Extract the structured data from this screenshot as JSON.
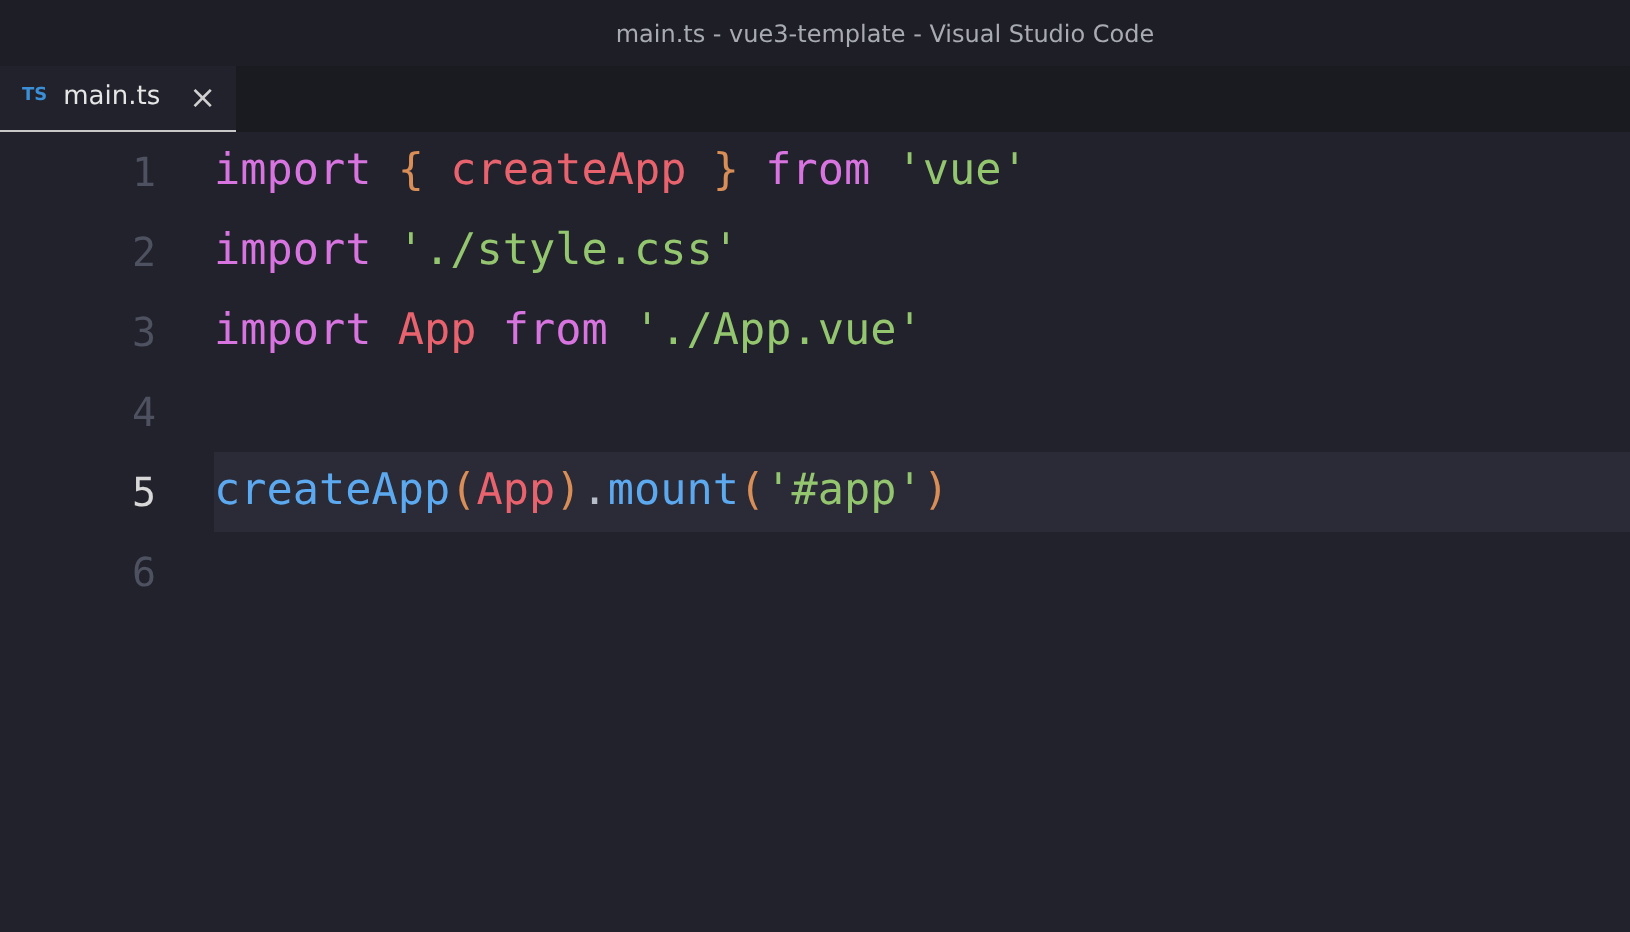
{
  "window": {
    "title": "main.ts - vue3-template - Visual Studio Code"
  },
  "tabs": [
    {
      "icon_text": "TS",
      "label": "main.ts",
      "close": "×",
      "selected": true
    }
  ],
  "editor": {
    "lines": [
      {
        "number": "1",
        "current": false,
        "tokens": [
          {
            "text": "import ",
            "kind": "keyword"
          },
          {
            "text": "{ ",
            "kind": "brace"
          },
          {
            "text": "createApp ",
            "kind": "variable"
          },
          {
            "text": "} ",
            "kind": "brace"
          },
          {
            "text": "from ",
            "kind": "keyword"
          },
          {
            "text": "'vue'",
            "kind": "string"
          }
        ]
      },
      {
        "number": "2",
        "current": false,
        "tokens": [
          {
            "text": "import ",
            "kind": "keyword"
          },
          {
            "text": "'./style.css'",
            "kind": "string"
          }
        ]
      },
      {
        "number": "3",
        "current": false,
        "tokens": [
          {
            "text": "import ",
            "kind": "keyword"
          },
          {
            "text": "App ",
            "kind": "variable"
          },
          {
            "text": "from ",
            "kind": "keyword"
          },
          {
            "text": "'./App.vue'",
            "kind": "string"
          }
        ]
      },
      {
        "number": "4",
        "current": false
      },
      {
        "number": "5",
        "current": true,
        "tokens": [
          {
            "text": "createApp",
            "kind": "function"
          },
          {
            "text": "(",
            "kind": "brace"
          },
          {
            "text": "App",
            "kind": "variable"
          },
          {
            "text": ")",
            "kind": "brace"
          },
          {
            "text": ".",
            "kind": "plain"
          },
          {
            "text": "mount",
            "kind": "function"
          },
          {
            "text": "(",
            "kind": "brace"
          },
          {
            "text": "'#app'",
            "kind": "string"
          },
          {
            "text": ")",
            "kind": "brace"
          }
        ]
      },
      {
        "number": "6",
        "current": false
      }
    ]
  }
}
